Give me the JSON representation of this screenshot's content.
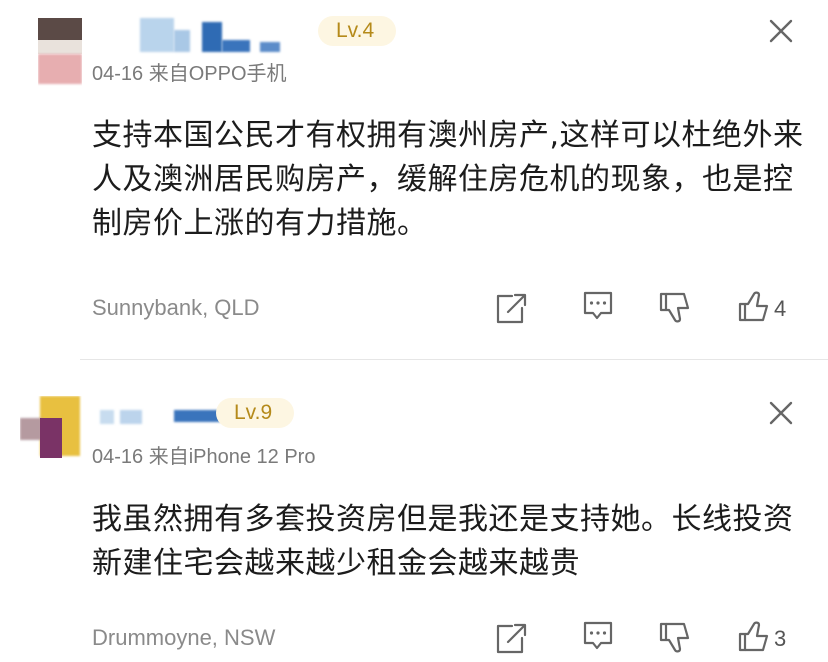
{
  "comments": [
    {
      "level": "Lv.4",
      "meta": "04-16  来自OPPO手机",
      "text": "支持本国公民才有权拥有澳州房产,这样可以杜绝外来人及澳洲居民购房产，缓解住房危机的现象，也是控制房价上涨的有力措施。",
      "location": "Sunnybank, QLD",
      "likes": "4"
    },
    {
      "level": "Lv.9",
      "meta": "04-16  来自iPhone 12 Pro",
      "text": "我虽然拥有多套投资房但是我还是支持她。长线投资新建住宅会越来越少租金会越来越贵",
      "location": "Drummoyne, NSW",
      "likes": "3"
    }
  ],
  "icons": [
    "close-icon",
    "share-icon",
    "comment-icon",
    "dislike-icon",
    "like-icon"
  ],
  "colors": {
    "level_bg": "#fdf6e2",
    "level_text": "#b58a1a",
    "muted": "#8a8a8a"
  }
}
